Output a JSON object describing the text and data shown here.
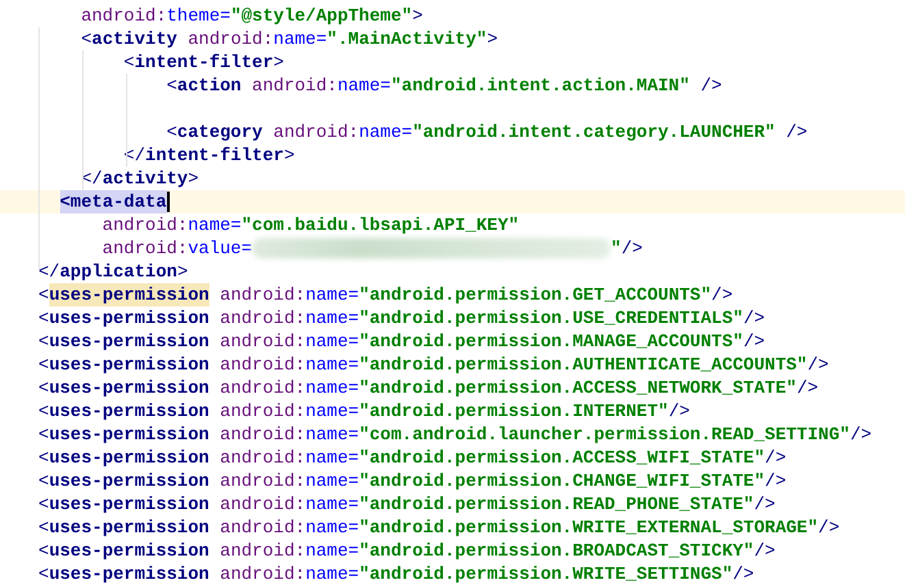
{
  "editor": {
    "lines": [
      {
        "current": false,
        "tokens": [
          {
            "kind": "ns",
            "text": "    android:"
          },
          {
            "kind": "attr",
            "text": "theme="
          },
          {
            "kind": "str",
            "text": "\"@style/AppTheme\""
          },
          {
            "kind": "p",
            "text": ">"
          }
        ]
      },
      {
        "current": false,
        "tokens": [
          {
            "kind": "p",
            "text": "    <"
          },
          {
            "kind": "tag",
            "text": "activity "
          },
          {
            "kind": "ns",
            "text": "android:"
          },
          {
            "kind": "attr",
            "text": "name="
          },
          {
            "kind": "str",
            "text": "\".MainActivity\""
          },
          {
            "kind": "p",
            "text": ">"
          }
        ]
      },
      {
        "current": false,
        "tokens": [
          {
            "kind": "p",
            "text": "        <"
          },
          {
            "kind": "tag",
            "text": "intent-filter"
          },
          {
            "kind": "p",
            "text": ">"
          }
        ]
      },
      {
        "current": false,
        "tokens": [
          {
            "kind": "p",
            "text": "            <"
          },
          {
            "kind": "tag",
            "text": "action "
          },
          {
            "kind": "ns",
            "text": "android:"
          },
          {
            "kind": "attr",
            "text": "name="
          },
          {
            "kind": "str",
            "text": "\"android.intent.action.MAIN\""
          },
          {
            "kind": "p",
            "text": " />"
          }
        ]
      },
      {
        "current": false
      },
      {
        "current": false,
        "tokens": [
          {
            "kind": "p",
            "text": "            <"
          },
          {
            "kind": "tag",
            "text": "category "
          },
          {
            "kind": "ns",
            "text": "android:"
          },
          {
            "kind": "attr",
            "text": "name="
          },
          {
            "kind": "str",
            "text": "\"android.intent.category.LAUNCHER\""
          },
          {
            "kind": "p",
            "text": " />"
          }
        ]
      },
      {
        "current": false,
        "tokens": [
          {
            "kind": "p",
            "text": "        </"
          },
          {
            "kind": "tag",
            "text": "intent-filter"
          },
          {
            "kind": "p",
            "text": ">"
          }
        ]
      },
      {
        "current": false,
        "tokens": [
          {
            "kind": "p",
            "text": "    </"
          },
          {
            "kind": "tag",
            "text": "activity"
          },
          {
            "kind": "p",
            "text": ">"
          }
        ]
      },
      {
        "current": true,
        "tokens": [
          {
            "kind": "selected",
            "text": "  <meta-data"
          }
        ]
      },
      {
        "current": false,
        "tokens": [
          {
            "kind": "ns",
            "text": "      android:"
          },
          {
            "kind": "attr",
            "text": "name="
          },
          {
            "kind": "str",
            "text": "\"com.baidu.lbsapi.API_KEY\""
          }
        ]
      },
      {
        "current": false,
        "tokens": [
          {
            "kind": "ns",
            "text": "      android:"
          },
          {
            "kind": "attr",
            "text": "value="
          },
          {
            "kind": "blur"
          },
          {
            "kind": "str",
            "text": "\""
          },
          {
            "kind": "p",
            "text": "/>"
          }
        ]
      },
      {
        "current": false,
        "tokens": [
          {
            "kind": "p",
            "text": "</"
          },
          {
            "kind": "tag",
            "text": "application"
          },
          {
            "kind": "p",
            "text": ">"
          }
        ]
      },
      {
        "current": false,
        "tokens": [
          {
            "kind": "p",
            "text": "<"
          },
          {
            "kind": "matched",
            "text": "uses-permission"
          },
          {
            "kind": "ns",
            "text": " android:"
          },
          {
            "kind": "attr",
            "text": "name="
          },
          {
            "kind": "str",
            "text": "\"android.permission.GET_ACCOUNTS\""
          },
          {
            "kind": "p",
            "text": "/>"
          }
        ]
      },
      {
        "current": false,
        "tokens": [
          {
            "kind": "p",
            "text": "<"
          },
          {
            "kind": "tag",
            "text": "uses-permission "
          },
          {
            "kind": "ns",
            "text": "android:"
          },
          {
            "kind": "attr",
            "text": "name="
          },
          {
            "kind": "str",
            "text": "\"android.permission.USE_CREDENTIALS\""
          },
          {
            "kind": "p",
            "text": "/>"
          }
        ]
      },
      {
        "current": false,
        "tokens": [
          {
            "kind": "p",
            "text": "<"
          },
          {
            "kind": "tag",
            "text": "uses-permission "
          },
          {
            "kind": "ns",
            "text": "android:"
          },
          {
            "kind": "attr",
            "text": "name="
          },
          {
            "kind": "str",
            "text": "\"android.permission.MANAGE_ACCOUNTS\""
          },
          {
            "kind": "p",
            "text": "/>"
          }
        ]
      },
      {
        "current": false,
        "tokens": [
          {
            "kind": "p",
            "text": "<"
          },
          {
            "kind": "tag",
            "text": "uses-permission "
          },
          {
            "kind": "ns",
            "text": "android:"
          },
          {
            "kind": "attr",
            "text": "name="
          },
          {
            "kind": "str",
            "text": "\"android.permission.AUTHENTICATE_ACCOUNTS\""
          },
          {
            "kind": "p",
            "text": "/>"
          }
        ]
      },
      {
        "current": false,
        "tokens": [
          {
            "kind": "p",
            "text": "<"
          },
          {
            "kind": "tag",
            "text": "uses-permission "
          },
          {
            "kind": "ns",
            "text": "android:"
          },
          {
            "kind": "attr",
            "text": "name="
          },
          {
            "kind": "str",
            "text": "\"android.permission.ACCESS_NETWORK_STATE\""
          },
          {
            "kind": "p",
            "text": "/>"
          }
        ]
      },
      {
        "current": false,
        "tokens": [
          {
            "kind": "p",
            "text": "<"
          },
          {
            "kind": "tag",
            "text": "uses-permission "
          },
          {
            "kind": "ns",
            "text": "android:"
          },
          {
            "kind": "attr",
            "text": "name="
          },
          {
            "kind": "str",
            "text": "\"android.permission.INTERNET\""
          },
          {
            "kind": "p",
            "text": "/>"
          }
        ]
      },
      {
        "current": false,
        "tokens": [
          {
            "kind": "p",
            "text": "<"
          },
          {
            "kind": "tag",
            "text": "uses-permission "
          },
          {
            "kind": "ns",
            "text": "android:"
          },
          {
            "kind": "attr",
            "text": "name="
          },
          {
            "kind": "str",
            "text": "\"com.android.launcher.permission.READ_SETTING\""
          },
          {
            "kind": "p",
            "text": "/>"
          }
        ]
      },
      {
        "current": false,
        "tokens": [
          {
            "kind": "p",
            "text": "<"
          },
          {
            "kind": "tag",
            "text": "uses-permission "
          },
          {
            "kind": "ns",
            "text": "android:"
          },
          {
            "kind": "attr",
            "text": "name="
          },
          {
            "kind": "str",
            "text": "\"android.permission.ACCESS_WIFI_STATE\""
          },
          {
            "kind": "p",
            "text": "/>"
          }
        ]
      },
      {
        "current": false,
        "tokens": [
          {
            "kind": "p",
            "text": "<"
          },
          {
            "kind": "tag",
            "text": "uses-permission "
          },
          {
            "kind": "ns",
            "text": "android:"
          },
          {
            "kind": "attr",
            "text": "name="
          },
          {
            "kind": "str",
            "text": "\"android.permission.CHANGE_WIFI_STATE\""
          },
          {
            "kind": "p",
            "text": "/>"
          }
        ]
      },
      {
        "current": false,
        "tokens": [
          {
            "kind": "p",
            "text": "<"
          },
          {
            "kind": "tag",
            "text": "uses-permission "
          },
          {
            "kind": "ns",
            "text": "android:"
          },
          {
            "kind": "attr",
            "text": "name="
          },
          {
            "kind": "str",
            "text": "\"android.permission.READ_PHONE_STATE\""
          },
          {
            "kind": "p",
            "text": "/>"
          }
        ]
      },
      {
        "current": false,
        "tokens": [
          {
            "kind": "p",
            "text": "<"
          },
          {
            "kind": "tag",
            "text": "uses-permission "
          },
          {
            "kind": "ns",
            "text": "android:"
          },
          {
            "kind": "attr",
            "text": "name="
          },
          {
            "kind": "str",
            "text": "\"android.permission.WRITE_EXTERNAL_STORAGE\""
          },
          {
            "kind": "p",
            "text": "/>"
          }
        ]
      },
      {
        "current": false,
        "tokens": [
          {
            "kind": "p",
            "text": "<"
          },
          {
            "kind": "tag",
            "text": "uses-permission "
          },
          {
            "kind": "ns",
            "text": "android:"
          },
          {
            "kind": "attr",
            "text": "name="
          },
          {
            "kind": "str",
            "text": "\"android.permission.BROADCAST_STICKY\""
          },
          {
            "kind": "p",
            "text": "/>"
          }
        ]
      },
      {
        "current": false,
        "tokens": [
          {
            "kind": "p",
            "text": "<"
          },
          {
            "kind": "tag",
            "text": "uses-permission "
          },
          {
            "kind": "ns",
            "text": "android:"
          },
          {
            "kind": "attr",
            "text": "name="
          },
          {
            "kind": "str",
            "text": "\"android.permission.WRITE_SETTINGS\""
          },
          {
            "kind": "p",
            "text": "/>"
          }
        ]
      }
    ]
  }
}
